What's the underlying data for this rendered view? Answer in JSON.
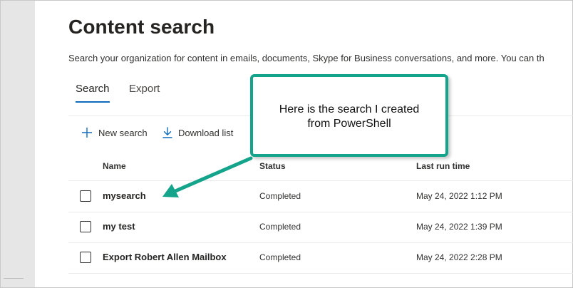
{
  "page": {
    "title": "Content search",
    "description": "Search your organization for content in emails, documents, Skype for Business conversations, and more. You can th"
  },
  "tabs": [
    {
      "label": "Search",
      "selected": true
    },
    {
      "label": "Export",
      "selected": false
    }
  ],
  "toolbar": {
    "new_search_label": "New search",
    "new_search_icon": "plus-icon",
    "download_list_label": "Download list",
    "download_list_icon": "download-icon"
  },
  "table": {
    "columns": [
      "Name",
      "Status",
      "Last run time"
    ],
    "rows": [
      {
        "name": "mysearch",
        "status": "Completed",
        "last_run": "May 24, 2022 1:12 PM"
      },
      {
        "name": "my test",
        "status": "Completed",
        "last_run": "May 24, 2022 1:39 PM"
      },
      {
        "name": "Export Robert Allen Mailbox",
        "status": "Completed",
        "last_run": "May 24, 2022 2:28 PM"
      }
    ]
  },
  "callout": {
    "text_line1": "Here is the search I created",
    "text_line2": "from PowerShell",
    "color": "#14a38b"
  },
  "colors": {
    "accent": "#0f6cbd",
    "annotation": "#14a38b"
  }
}
